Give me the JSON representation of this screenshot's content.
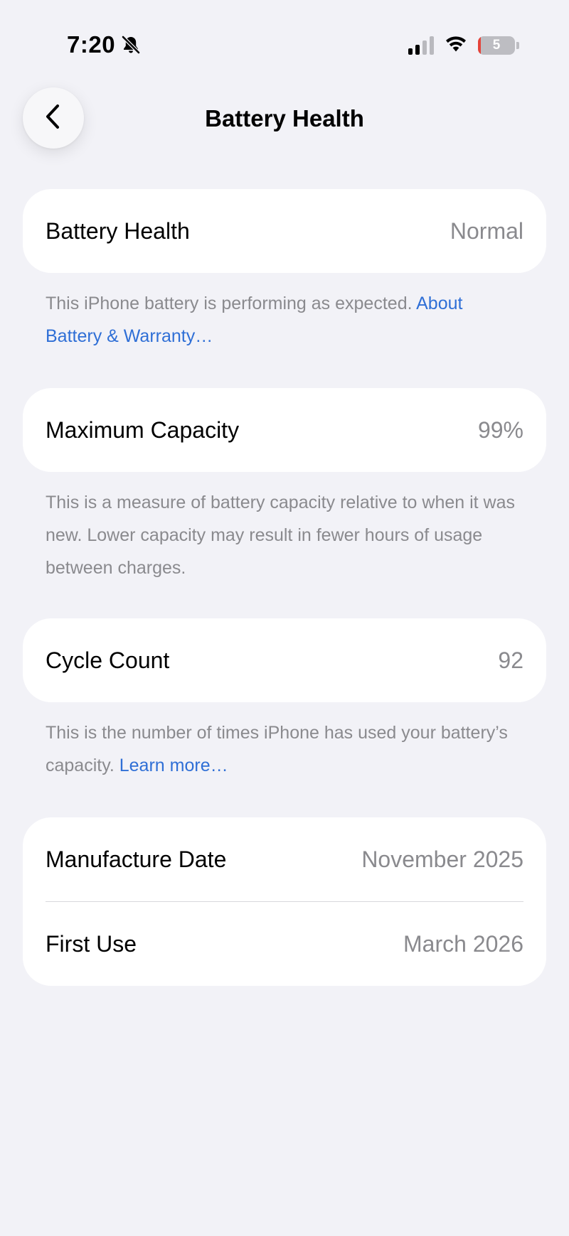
{
  "status_bar": {
    "time": "7:20",
    "battery_level": "5",
    "battery_fraction": 0.05,
    "icons": [
      "bell-slash-icon",
      "signal-icon",
      "wifi-icon",
      "battery-icon"
    ]
  },
  "nav": {
    "back_icon": "chevron-left-icon",
    "title": "Battery Health"
  },
  "sections": {
    "health": {
      "label": "Battery Health",
      "value": "Normal",
      "note_text": "This iPhone battery is performing as expected. ",
      "note_link": "About Battery & Warranty…"
    },
    "capacity": {
      "label": "Maximum Capacity",
      "value": "99%",
      "note_text": "This is a measure of battery capacity relative to when it was new. Lower capacity may result in fewer hours of usage between charges."
    },
    "cycles": {
      "label": "Cycle Count",
      "value": "92",
      "note_text": "This is the number of times iPhone has used your battery’s capacity. ",
      "note_link": "Learn more…"
    },
    "dates": {
      "manufacture_label": "Manufacture Date",
      "manufacture_value": "November 2025",
      "first_use_label": "First Use",
      "first_use_value": "March 2026"
    }
  },
  "colors": {
    "background": "#f2f2f7",
    "card": "#ffffff",
    "secondary_text": "#8a8a8e",
    "link": "#2f6fd6",
    "battery_low": "#e5433a"
  }
}
